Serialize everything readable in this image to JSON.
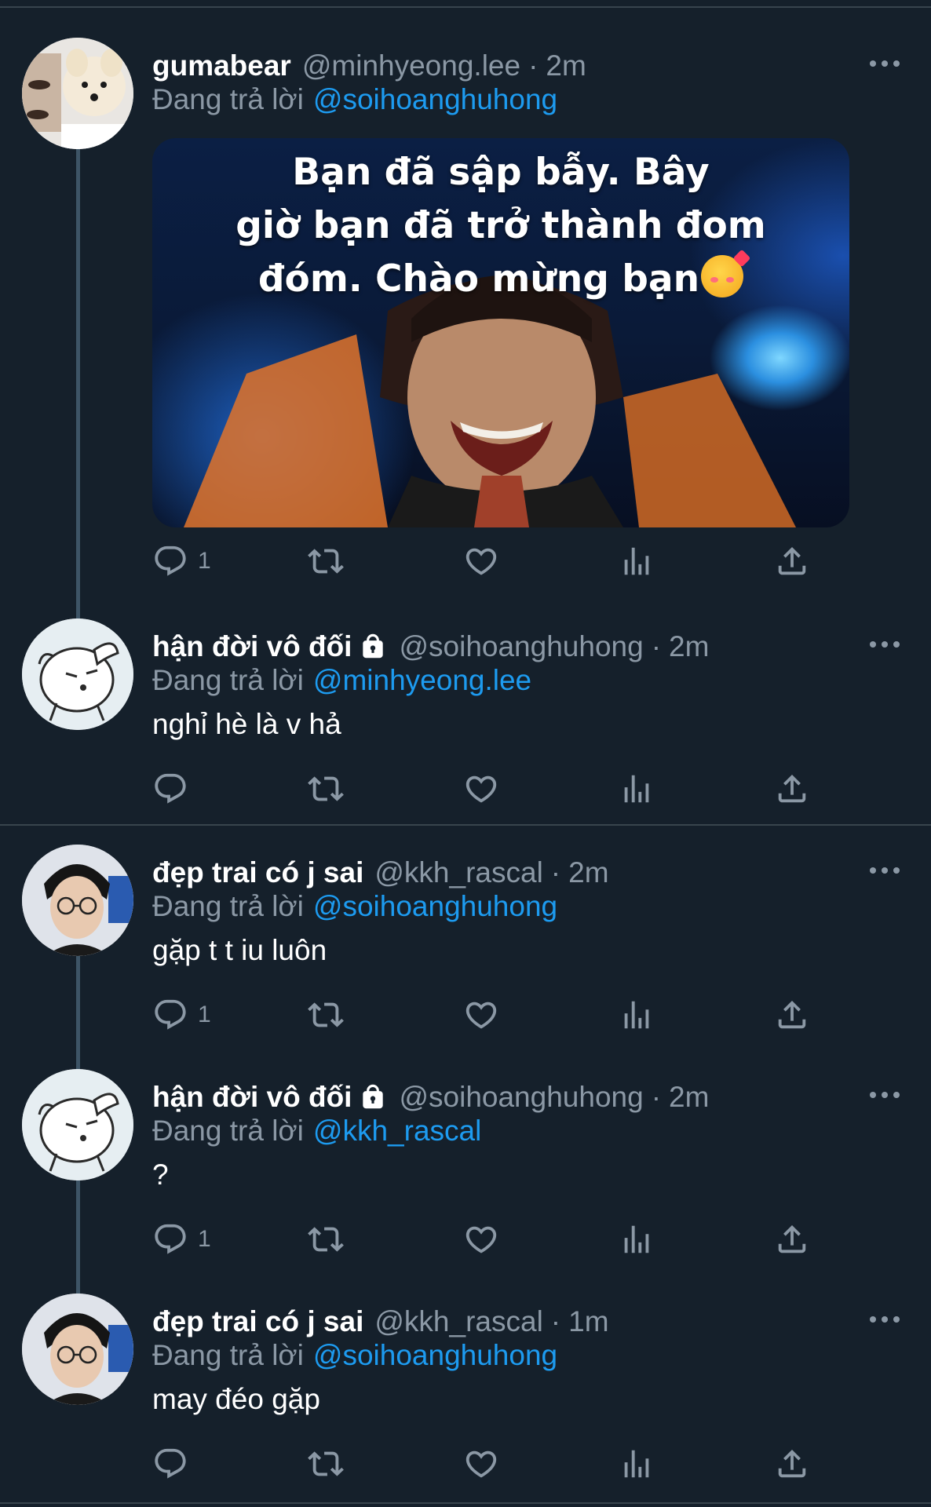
{
  "tweets": [
    {
      "name": "gumabear",
      "handle": "@minhyeong.lee",
      "time": "2m",
      "reply_label": "Đang trả lời",
      "reply_to": "@soihoanghuhong",
      "media_text": [
        "Bạn đã sập bẫy. Bây",
        "giờ bạn đã trở thành đom",
        "đóm. Chào mừng bạn"
      ],
      "replies": "1",
      "avatar": "pomeranian-avatar"
    },
    {
      "name": "hận đời vô đối",
      "locked": true,
      "handle": "@soihoanghuhong",
      "time": "2m",
      "reply_label": "Đang trả lời",
      "reply_to": "@minhyeong.lee",
      "text": "nghỉ hè là v hả",
      "replies": "",
      "avatar": "cartoon-dog-avatar"
    },
    {
      "name": "đẹp trai có j sai",
      "handle": "@kkh_rascal",
      "time": "2m",
      "reply_label": "Đang trả lời",
      "reply_to": "@soihoanghuhong",
      "text": "gặp t t iu luôn",
      "replies": "1",
      "avatar": "glasses-selfie-avatar"
    },
    {
      "name": "hận đời vô đối",
      "locked": true,
      "handle": "@soihoanghuhong",
      "time": "2m",
      "reply_label": "Đang trả lời",
      "reply_to": "@kkh_rascal",
      "text": "?",
      "replies": "1",
      "avatar": "cartoon-dog-avatar"
    },
    {
      "name": "đẹp trai có j sai",
      "handle": "@kkh_rascal",
      "time": "1m",
      "reply_label": "Đang trả lời",
      "reply_to": "@soihoanghuhong",
      "text": "may đéo gặp",
      "replies": "",
      "avatar": "glasses-selfie-avatar"
    }
  ],
  "colors": {
    "background": "#15202b",
    "mention": "#1d9bf0",
    "secondary": "#8b98a5",
    "divider": "#38444d"
  },
  "icons": [
    "reply-icon",
    "retweet-icon",
    "like-icon",
    "analytics-icon",
    "share-icon",
    "more-icon",
    "lock-icon"
  ]
}
